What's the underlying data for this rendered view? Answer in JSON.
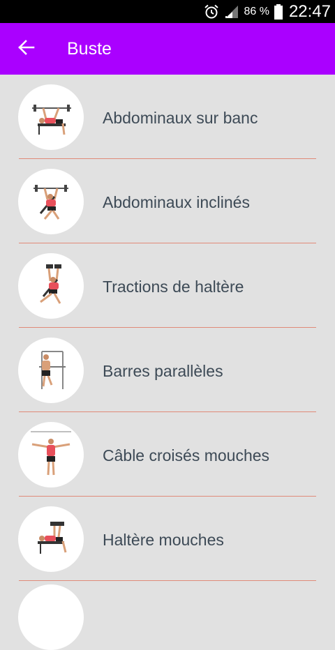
{
  "status_bar": {
    "battery_percent": "86 %",
    "time": "22:47",
    "icons": [
      "alarm-icon",
      "signal-icon",
      "battery-icon"
    ]
  },
  "app_bar": {
    "title": "Buste",
    "back_icon": "arrow-left-icon",
    "color": "#aa00ff"
  },
  "exercises": [
    {
      "label": "Abdominaux sur banc",
      "icon": "bench-press-figure-icon"
    },
    {
      "label": "Abdominaux inclinés",
      "icon": "incline-press-figure-icon"
    },
    {
      "label": "Tractions de haltère",
      "icon": "dumbbell-press-figure-icon"
    },
    {
      "label": "Barres parallèles",
      "icon": "parallel-bars-figure-icon"
    },
    {
      "label": "Câble croisés mouches",
      "icon": "cable-crossover-figure-icon"
    },
    {
      "label": "Haltère mouches",
      "icon": "dumbbell-fly-figure-icon"
    }
  ],
  "colors": {
    "background": "#e1e1e1",
    "divider": "#e08a78",
    "label_text": "#3d4a56",
    "shirt": "#e8505b"
  }
}
